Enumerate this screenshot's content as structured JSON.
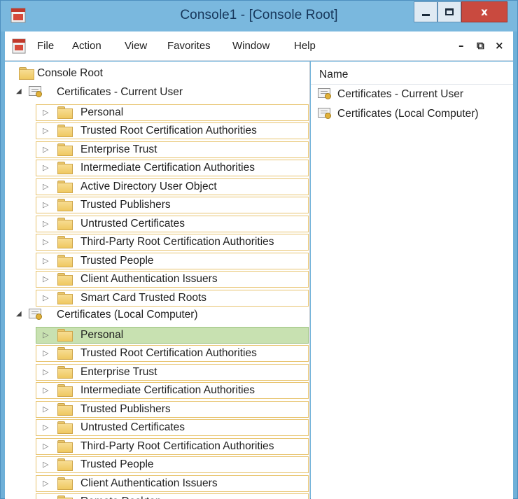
{
  "window": {
    "title": "Console1 - [Console Root]",
    "colors": {
      "titlebar": "#7ab8de",
      "close_button": "#c94a3f",
      "selection": "#c8e1b1",
      "row_border": "#e8c46f"
    }
  },
  "controls": {
    "minimize": "–",
    "maximize": "□",
    "close": "x"
  },
  "menubar": {
    "items": [
      "File",
      "Action",
      "View",
      "Favorites",
      "Window",
      "Help"
    ],
    "mdi_controls": [
      "–",
      "⧉",
      "×"
    ]
  },
  "tree": {
    "root_label": "Console Root",
    "groups": [
      {
        "label": "Certificates - Current User",
        "expanded": true,
        "children": [
          "Personal",
          "Trusted Root Certification Authorities",
          "Enterprise Trust",
          "Intermediate Certification Authorities",
          "Active Directory User Object",
          "Trusted Publishers",
          "Untrusted Certificates",
          "Third-Party Root Certification Authorities",
          "Trusted People",
          "Client Authentication Issuers",
          "Smart Card Trusted Roots"
        ]
      },
      {
        "label": "Certificates (Local Computer)",
        "expanded": true,
        "selected_child": "Personal",
        "children": [
          "Personal",
          "Trusted Root Certification Authorities",
          "Enterprise Trust",
          "Intermediate Certification Authorities",
          "Trusted Publishers",
          "Untrusted Certificates",
          "Third-Party Root Certification Authorities",
          "Trusted People",
          "Client Authentication Issuers",
          "Remote Desktop"
        ]
      }
    ]
  },
  "details": {
    "column_header": "Name",
    "items": [
      "Certificates - Current User",
      "Certificates (Local Computer)"
    ]
  }
}
